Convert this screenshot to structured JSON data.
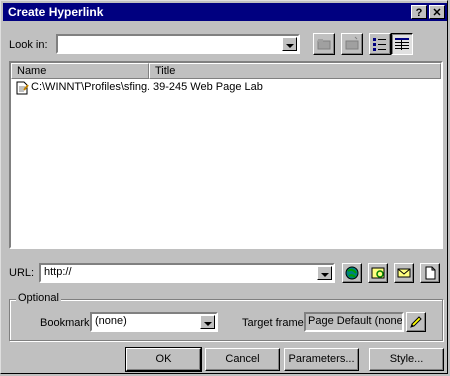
{
  "window": {
    "title": "Create Hyperlink",
    "help_glyph": "?",
    "close_glyph": "✕"
  },
  "look_in": {
    "label": "Look in:",
    "accel": "L",
    "value": ""
  },
  "file_list": {
    "columns": [
      "Name",
      "Title"
    ],
    "rows": [
      {
        "name": "C:\\WINNT\\Profiles\\sfing...",
        "title": "39-245 Web Page Lab",
        "icon": "html-document-icon"
      }
    ]
  },
  "url": {
    "label": "URL:",
    "accel": "U",
    "value": "http://"
  },
  "optional": {
    "title": "Optional",
    "bookmark_label": "Bookmark:",
    "bookmark_value": "(none)",
    "target_label": "Target frame:",
    "target_value": "Page Default (none)"
  },
  "buttons": {
    "ok": "OK",
    "cancel": "Cancel",
    "parameters": "Parameters...",
    "style": "Style..."
  }
}
